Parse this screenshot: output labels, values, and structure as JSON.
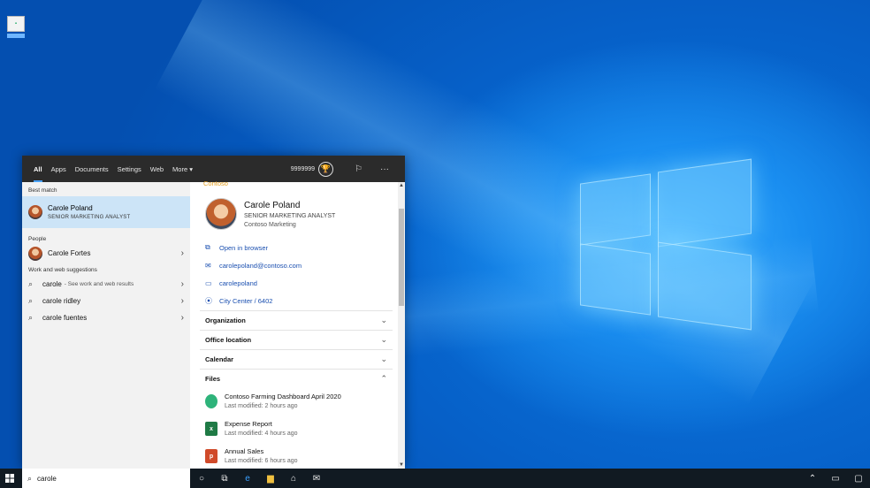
{
  "desktop": {
    "icon_name": "app-shortcut-icon"
  },
  "search_panel": {
    "tabs": [
      "All",
      "Apps",
      "Documents",
      "Settings",
      "Web",
      "More ▾"
    ],
    "points": "9999999",
    "left": {
      "best_match_label": "Best match",
      "best_match": {
        "name": "Carole Poland",
        "title": "SENIOR MARKETING ANALYST"
      },
      "people_label": "People",
      "people": [
        {
          "name": "Carole Fortes"
        }
      ],
      "suggestions_label": "Work and web suggestions",
      "suggestions": [
        {
          "query": "carole",
          "hint": "- See work and web results"
        },
        {
          "query": "carole ridley",
          "hint": ""
        },
        {
          "query": "carole fuentes",
          "hint": ""
        }
      ]
    },
    "right": {
      "org_tag": "Contoso",
      "profile": {
        "name": "Carole Poland",
        "title": "SENIOR MARKETING ANALYST",
        "department": "Contoso Marketing"
      },
      "links": [
        {
          "icon": "open-browser-icon",
          "text": "Open in browser"
        },
        {
          "icon": "mail-icon",
          "text": "carolepoland@contoso.com"
        },
        {
          "icon": "chat-icon",
          "text": "carolepoland"
        },
        {
          "icon": "location-icon",
          "text": "City Center / 6402"
        }
      ],
      "sections": [
        "Organization",
        "Office location",
        "Calendar",
        "Files"
      ],
      "files": [
        {
          "name": "Contoso Farming Dashboard April 2020",
          "modified": "Last modified: 2 hours ago",
          "icon": "powerbi-icon",
          "color": "#2eb37a"
        },
        {
          "name": "Expense Report",
          "modified": "Last modified: 4 hours ago",
          "icon": "excel-icon",
          "color": "#1f7a45"
        },
        {
          "name": "Annual Sales",
          "modified": "Last modified: 6 hours ago",
          "icon": "powerpoint-icon",
          "color": "#d04a2a"
        }
      ]
    }
  },
  "taskbar": {
    "search_value": "carole"
  },
  "colors": {
    "accent": "#4aa3ff",
    "selection": "#cce4f7",
    "link": "#1a4fb0",
    "taskbar": "#111a22"
  }
}
